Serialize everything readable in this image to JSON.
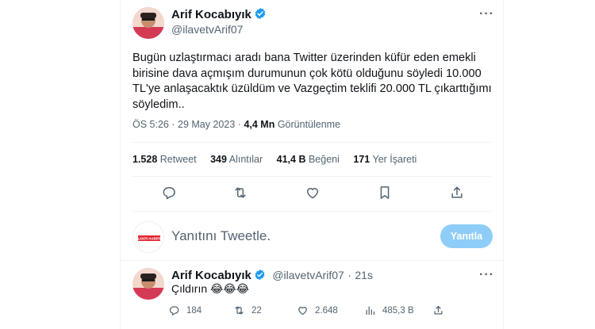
{
  "tweet": {
    "author_name": "Arif Kocabıyık",
    "author_handle": "@ilavetvArif07",
    "text": "Bugün uzlaştırmacı aradı bana Twitter üzerinden küfür eden emekli birisine dava açmışım durumunun çok kötü olduğunu söyledi 10.000 TL'ye anlaşacaktık üzüldüm ve Vazgeçtim teklifi 20.000 TL çıkarttığımı söyledim..",
    "time": "ÖS 5:26",
    "separator": "·",
    "date": "29 May 2023",
    "views_count": "4,4 Mn",
    "views_label": "Görüntülenme",
    "stats": [
      {
        "count": "1.528",
        "label": "Retweet"
      },
      {
        "count": "349",
        "label": "Alıntılar"
      },
      {
        "count": "41,4 B",
        "label": "Beğeni"
      },
      {
        "count": "171",
        "label": "Yer İşareti"
      }
    ]
  },
  "compose": {
    "placeholder": "Yanıtını Tweetle.",
    "button_label": "Yanıtla",
    "avatar_text": "LIDER HABER"
  },
  "reply": {
    "author_name": "Arif Kocabıyık",
    "author_handle": "@ilavetvArif07",
    "separator": "·",
    "time": "21s",
    "text": "Çıldırın 😂😂😂",
    "counts": {
      "replies": "184",
      "retweets": "22",
      "likes": "2.648",
      "views": "485,3 B"
    }
  },
  "colors": {
    "verified": "#1d9bf0",
    "muted": "#536471",
    "text": "#0f1419",
    "reply_button": "#8ecdf7"
  }
}
